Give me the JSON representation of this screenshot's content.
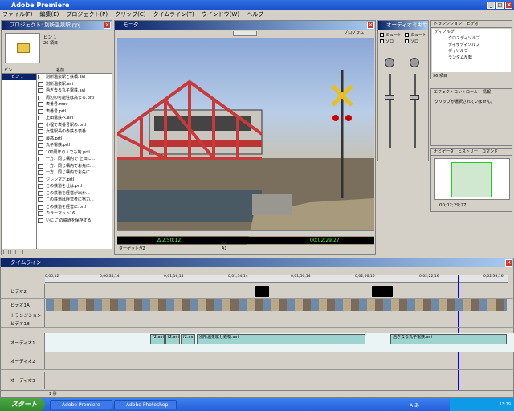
{
  "app": {
    "title": "Adobe Premiere"
  },
  "menu": [
    "ファイル(F)",
    "編集(E)",
    "プロジェクト(P)",
    "クリップ(C)",
    "タイムライン(T)",
    "ウインドウ(W)",
    "ヘルプ"
  ],
  "project": {
    "title": "プロジェクト: 別所温泉駅.ppj",
    "bin_name": "ビン 1",
    "bin_count": "26 項目",
    "col_bin": "ビン",
    "col_name": "名前",
    "bin_item": "ビン 1",
    "items": [
      "別所温泉駅と鉄橋.avi",
      "別所温泉駅.avi",
      "過ぎ去る丸子電鉄.avi",
      "周辺の可能性は高まる.prtl",
      "表番号.mov",
      "表番号.prtl",
      "上田電鉄へ.avi",
      "小程で表番号駅の.prtl",
      "女性駅長の赤鉄る表番...",
      "最高.prtl",
      "丸子電鉄.prtl",
      "100周年の人でも地.prtl",
      "一方、同じ構内で 上田に...",
      "一方、同じ構内でお先に...",
      "一方、同じ構内でお先に...",
      "ジレンマだ.prtl",
      "この鉄道を仕は.prtl",
      "この鉄道を経営が出か...",
      "この鉄道は経営者に努力...",
      "この鉄道を経営に.prtl",
      "カラーマット16",
      "いに この鉄道を保存する"
    ]
  },
  "monitor": {
    "title": "モニタ",
    "program_label": "プログラム",
    "timecode_left": "Δ 2;50;12",
    "timecode_right": "00;02;29;27",
    "target_label": "ターゲット:",
    "target_video": "V2",
    "target_audio": "A1"
  },
  "mixer": {
    "title": "オーディオミキサー",
    "mute": "ミュート",
    "solo": "ソロ"
  },
  "transitions": {
    "tab1": "トランジション",
    "tab2": "ビデオ",
    "folder": "ディゾルブ",
    "items": [
      "クロスディゾルブ",
      "ディザディゾルブ",
      "ディゾルブ",
      "ランダム反転"
    ],
    "footer": "36 項目"
  },
  "effect_control": {
    "tab1": "エフェクトコントロール",
    "tab2": "情報",
    "message": "クリップが選択されていません。"
  },
  "navigator": {
    "tab1": "ナビゲータ",
    "tab2": "ヒストリー",
    "tab3": "コマンド",
    "timecode": "00;02;29;27"
  },
  "timeline": {
    "title": "タイムライン",
    "ruler": [
      "0;00;12",
      "0;00;34;14",
      "0;01;16;14",
      "0;01;34;14",
      "0;01;50;14",
      "0;02;06;16",
      "0;02;22;16",
      "0;02;38;16"
    ],
    "tracks": [
      "ビデオ2",
      "ビデオ1A",
      "トランジション",
      "ビデオ1B",
      "オーディオ1",
      "オーディオ2",
      "オーディオ3"
    ],
    "clip_audio1": "別所温泉駅と鉄橋.avi",
    "clip_audio2": "過ぎ去る丸子電鉄.avi",
    "small_clip": "f2.avi",
    "zoom": "1 秒"
  },
  "taskbar": {
    "start": "スタート",
    "tasks": [
      "Adobe Premiere",
      "Adobe Photoshop"
    ],
    "time": "13:19",
    "ime": "A あ"
  },
  "colors": {
    "titlebar": "#1a4fc9",
    "panel": "#d4d0c8",
    "accent": "#0a246a"
  }
}
